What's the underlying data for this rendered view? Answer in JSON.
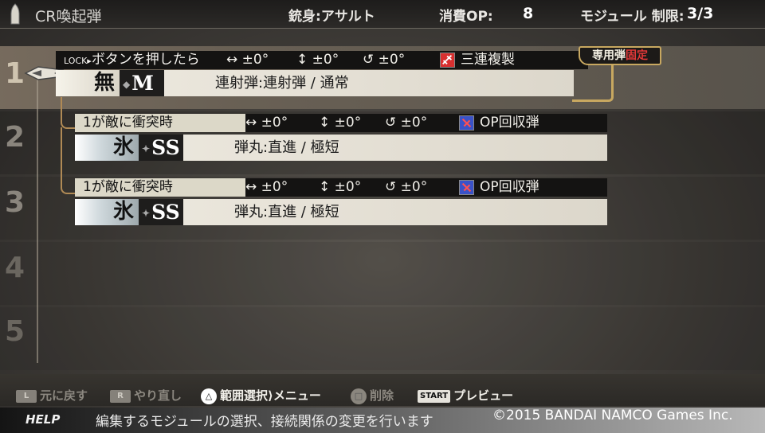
{
  "header": {
    "title": "CR喚起弾",
    "barrel": "銃身:アサルト",
    "op_label": "消費OP:",
    "op_value": "8",
    "module_label": "モジュール 制限:",
    "module_value": "3/3"
  },
  "slots": [
    "1",
    "2",
    "3",
    "4",
    "5"
  ],
  "modules": [
    {
      "lock": "LOCK▸",
      "trigger": "ボタンを押したら",
      "horiz": "↔ ±0°",
      "vert": "↕ ±0°",
      "rot": "↺ ±0°",
      "chip": "三連複製",
      "element": "無",
      "size": "M",
      "desc": "連射弾:連射弾 / 通常"
    },
    {
      "trigger": "1が敵に衝突時",
      "horiz": "↔ ±0°",
      "vert": "↕ ±0°",
      "rot": "↺ ±0°",
      "chip": "OP回収弾",
      "element": "氷",
      "size": "SS",
      "desc": "弾丸:直進 / 極短"
    },
    {
      "trigger": "1が敵に衝突時",
      "horiz": "↔ ±0°",
      "vert": "↕ ±0°",
      "rot": "↺ ±0°",
      "chip": "OP回収弾",
      "element": "氷",
      "size": "SS",
      "desc": "弾丸:直進 / 極短"
    }
  ],
  "fixed_tag": {
    "part1": "専用弾",
    "part2": "固定"
  },
  "controls": [
    {
      "key": "L",
      "label": "元に戻す",
      "enabled": false
    },
    {
      "key": "R",
      "label": "やり直し",
      "enabled": false
    },
    {
      "key": "△",
      "label": "範囲選択⟩メニュー",
      "enabled": true
    },
    {
      "key": "□",
      "label": "削除",
      "enabled": false
    },
    {
      "key": "START",
      "label": "プレビュー",
      "enabled": true
    }
  ],
  "help": {
    "label": "HELP",
    "text": "編集するモジュールの選択、接続関係の変更を行います",
    "copyright": "©2015 BANDAI NAMCO Games Inc."
  },
  "colors": {
    "accent_gold": "#c8a860",
    "fixed_red": "#e33838"
  }
}
